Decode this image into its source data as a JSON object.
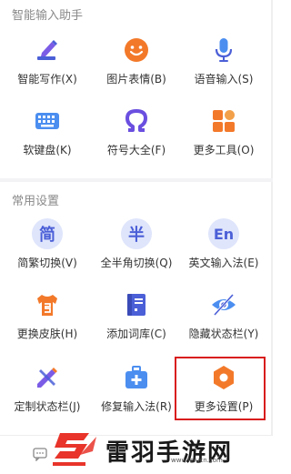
{
  "sections": {
    "smart_title": "智能输入助手",
    "common_title": "常用设置"
  },
  "items": {
    "smart_write": "智能写作(X)",
    "picture_emoji": "图片表情(B)",
    "voice_input": "语音输入(S)",
    "soft_keyboard": "软键盘(K)",
    "symbols": "符号大全(F)",
    "more_tools": "更多工具(O)",
    "simp_trad": "简繁切换(V)",
    "full_half": "全半角切换(Q)",
    "english_input": "英文输入法(E)",
    "change_skin": "更换皮肤(H)",
    "add_dict": "添加词库(C)",
    "hide_status": "隐藏状态栏(Y)",
    "custom_status": "定制状态栏(J)",
    "repair_input": "修复输入法(R)",
    "more_settings": "更多设置(P)"
  },
  "glyphs": {
    "simp": "简",
    "half": "半",
    "en": "En"
  },
  "watermark": {
    "brand": "雷羽手游网",
    "url": "www.leiucn.com"
  },
  "colors": {
    "accent_blue": "#4b5fd7",
    "accent_orange": "#f3792a",
    "highlight_red": "#d91c1c"
  }
}
